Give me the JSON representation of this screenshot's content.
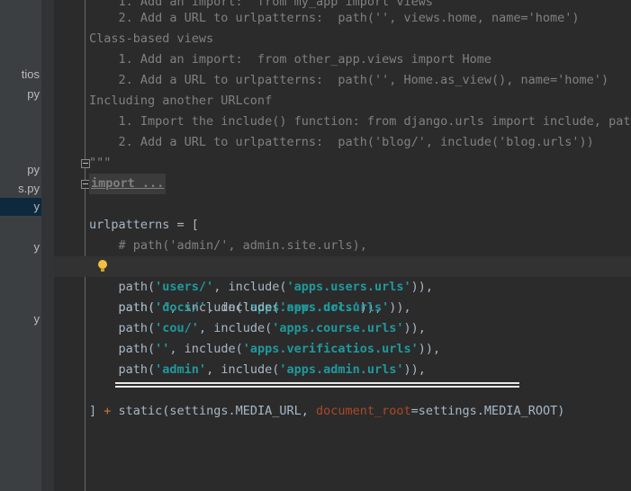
{
  "sidebar": {
    "items": [
      {
        "label": "tios"
      },
      {
        "label": "py"
      },
      {
        "label": "py"
      },
      {
        "label": "s.py"
      },
      {
        "label": "y"
      },
      {
        "label": "y"
      },
      {
        "label": "y"
      }
    ]
  },
  "code": {
    "l1": "    1. Add an import:  from my_app import views",
    "l2": "    2. Add a URL to urlpatterns:  path('', views.home, name='home')",
    "l3": "Class-based views",
    "l4": "    1. Add an import:  from other_app.views import Home",
    "l5": "    2. Add a URL to urlpatterns:  path('', Home.as_view(), name='home')",
    "l6": "Including another URLconf",
    "l7": "    1. Import the include() function: from django.urls import include, path",
    "l8": "    2. Add a URL to urlpatterns:  path('blog/', include('blog.urls'))",
    "l9": "\"\"\"",
    "l10": "import ...",
    "l12a": "urlpatterns = [",
    "l13": "    # path('admin/', admin.site.urls),",
    "rows": [
      {
        "pre": "    path(",
        "s1": "''",
        "mid": ", include(",
        "s2": "'apps.news.urls'",
        "post": ")),"
      },
      {
        "pre": "    path(",
        "s1": "'users/'",
        "mid": ", include(",
        "s2": "'apps.users.urls'",
        "post": ")),"
      },
      {
        "pre": "    path(",
        "s1": "'docs/'",
        "mid": ", include(",
        "s2": "'apps.doc.urls'",
        "post": ")),"
      },
      {
        "pre": "    path(",
        "s1": "'cou/'",
        "mid": ", include(",
        "s2": "'apps.course.urls'",
        "post": ")),"
      },
      {
        "pre": "    path(",
        "s1": "''",
        "mid": ", include(",
        "s2": "'apps.verificatios.urls'",
        "post": ")),"
      },
      {
        "pre": "    path(",
        "s1": "'admin'",
        "mid": ", include(",
        "s2": "'apps.admin.urls'",
        "post": ")),"
      }
    ],
    "last_a": "] ",
    "last_plus": "+",
    "last_b": " static(settings.MEDIA_URL, ",
    "last_param": "document_root",
    "last_c": "=settings.MEDIA_ROOT)"
  }
}
